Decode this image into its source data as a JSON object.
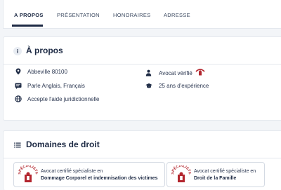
{
  "tabs": [
    {
      "label": "A PROPOS"
    },
    {
      "label": "PRÉSENTATION"
    },
    {
      "label": "HONORAIRES"
    },
    {
      "label": "ADRESSE"
    }
  ],
  "about": {
    "title": "À propos",
    "icon": "info-icon",
    "location": "Abbeville 80100",
    "languages": "Parle Anglais, Français",
    "legal_aid": "Accepte l'aide juridictionnelle",
    "verified": "Avocat vérifié",
    "experience": "25 ans d'expérience"
  },
  "domains": {
    "title": "Domaines de droit",
    "icon": "list-icon",
    "badge_text": "SPÉCIALISTE",
    "items": [
      {
        "line1": "Avocat certifié spécialiste en",
        "line2": "Dommage Corporel et indemnisation des victimes"
      },
      {
        "line1": "Avocat certifié spécialiste en",
        "line2": "Droit de la Famille"
      }
    ]
  },
  "colors": {
    "primary": "#1d2a44",
    "seal_red": "#b3262e",
    "background": "#f3f5f8"
  }
}
